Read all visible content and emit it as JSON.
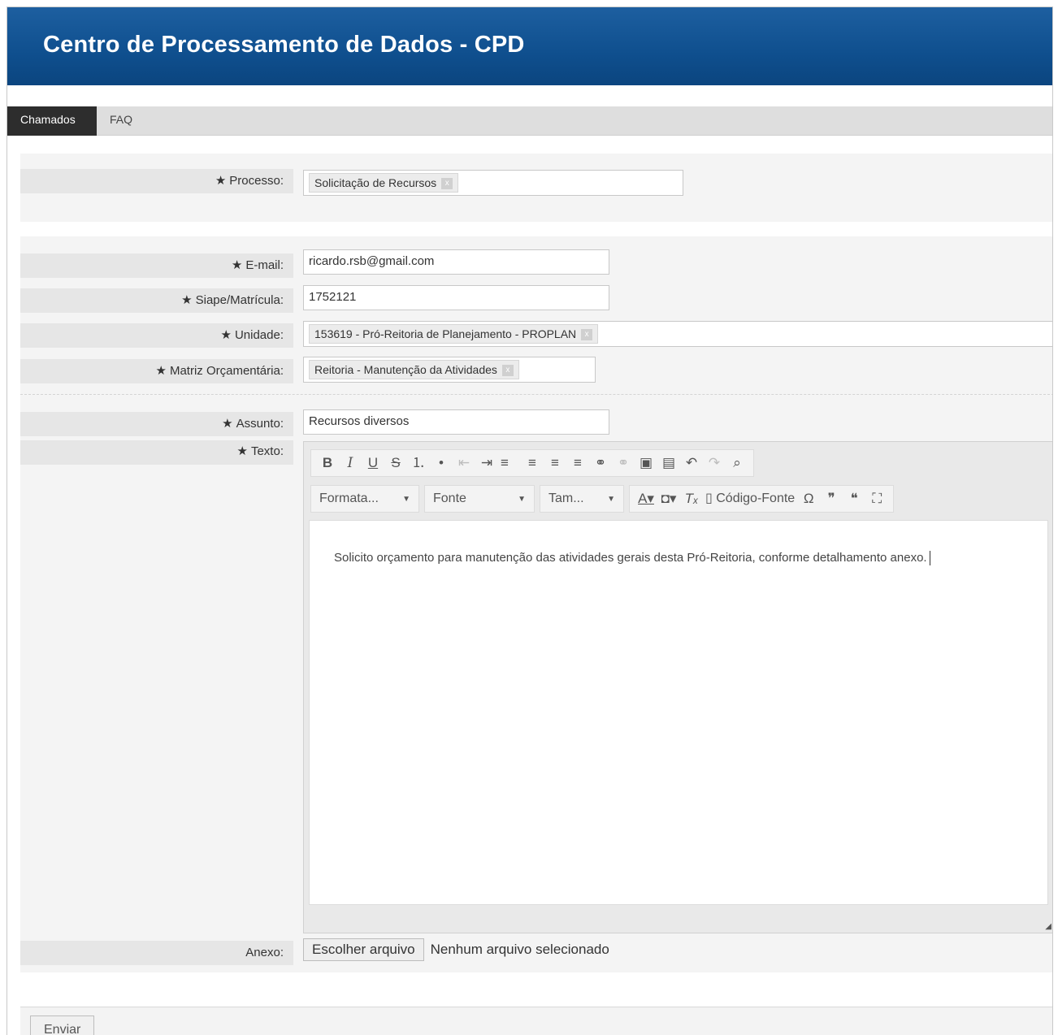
{
  "header": {
    "title": "Centro de Processamento de Dados - CPD"
  },
  "tabs": [
    {
      "label": "Chamados",
      "active": true
    },
    {
      "label": "FAQ",
      "active": false
    }
  ],
  "form": {
    "required_mark": "★",
    "processo": {
      "label": "Processo:",
      "tag": "Solicitação de Recursos"
    },
    "email": {
      "label": "E-mail:",
      "value": "ricardo.rsb@gmail.com"
    },
    "siape": {
      "label": "Siape/Matrícula:",
      "value": "1752121"
    },
    "unidade": {
      "label": "Unidade:",
      "tag": "153619 - Pró-Reitoria de Planejamento - PROPLAN"
    },
    "matriz": {
      "label": "Matriz Orçamentária:",
      "tag": "Reitoria - Manutenção da Atividades"
    },
    "assunto": {
      "label": "Assunto:",
      "value": "Recursos diversos"
    },
    "texto": {
      "label": "Texto:"
    },
    "anexo": {
      "label": "Anexo:",
      "button": "Escolher arquivo",
      "status": "Nenhum arquivo selecionado"
    },
    "submit": "Enviar"
  },
  "editor": {
    "toolbar_row1": [
      "B",
      "I",
      "U",
      "S",
      "⒈",
      "•",
      "⇤",
      "⇥",
      "≡",
      "≡",
      "≡",
      "≡",
      "⚭",
      "⚭",
      "▣",
      "▤",
      "↶",
      "↷",
      "⌕"
    ],
    "format_combo": "Formata...",
    "font_combo": "Fonte",
    "size_combo": "Tam...",
    "source_label": "Código-Fonte",
    "content": "Solicito orçamento para manutenção das atividades gerais desta Pró-Reitoria, conforme detalhamento anexo."
  },
  "colors": {
    "header_bg": "#0f4f8e",
    "tab_active_bg": "#2d2d2d",
    "label_bg": "#e6e6e6"
  }
}
